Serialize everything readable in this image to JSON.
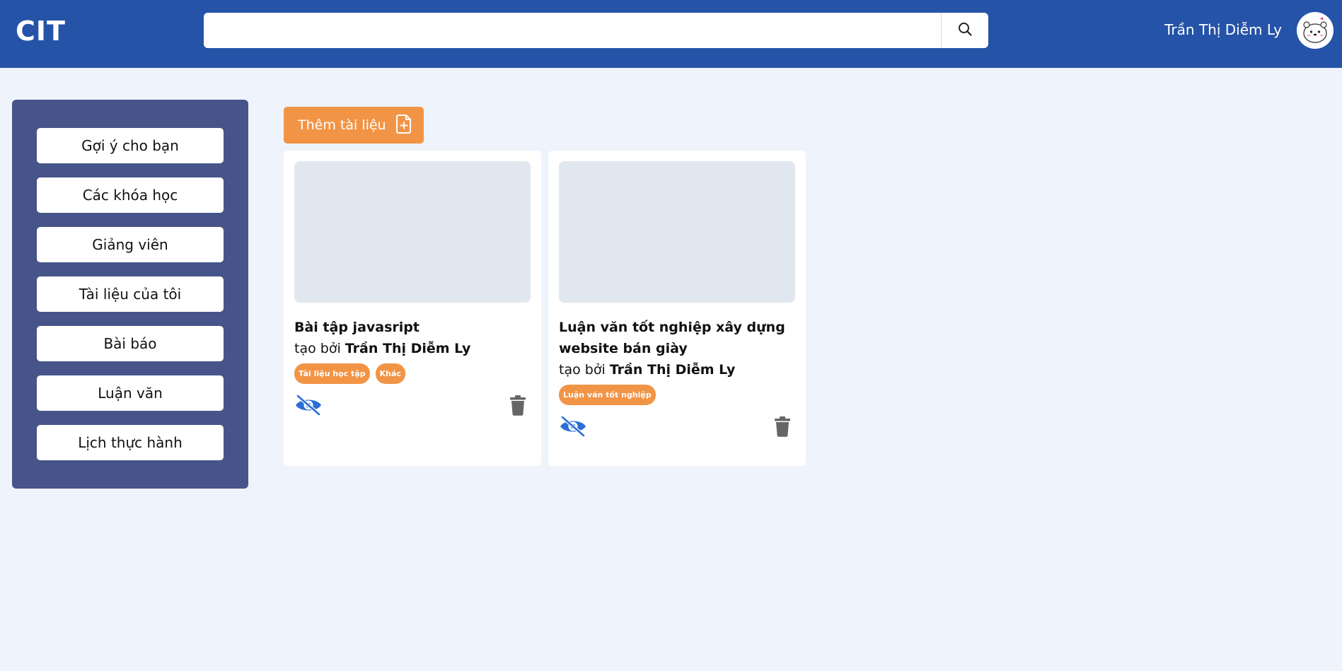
{
  "header": {
    "logo": "CIT",
    "search": {
      "value": "",
      "placeholder": ""
    },
    "user_name": "Trần Thị Diễm Ly"
  },
  "sidebar": {
    "items": [
      {
        "label": "Gợi ý cho bạn"
      },
      {
        "label": "Các khóa học"
      },
      {
        "label": "Giảng viên"
      },
      {
        "label": "Tài liệu của tôi"
      },
      {
        "label": "Bài báo"
      },
      {
        "label": "Luận văn"
      },
      {
        "label": "Lịch thực hành"
      }
    ]
  },
  "main": {
    "add_button_label": "Thêm tài liệu",
    "cards": [
      {
        "title": "Bài tập javasript",
        "created_by_prefix": "tạo bởi",
        "author": "Trần Thị Diễm Ly",
        "tags": [
          "Tài liệu học tập",
          "Khác"
        ]
      },
      {
        "title": "Luận văn tốt nghiệp xây dựng website bán giày",
        "created_by_prefix": "tạo bởi",
        "author": "Trần Thị Diễm Ly",
        "tags": [
          "Luận văn tốt nghiệp"
        ]
      }
    ]
  },
  "colors": {
    "header_bg": "#2553a8",
    "sidebar_bg": "#465489",
    "accent_orange": "#f29446",
    "eye_icon": "#2a6fd6",
    "trash_icon": "#666666",
    "page_bg": "#eff3fc"
  },
  "icons": {
    "search": "search-icon",
    "add_document": "file-plus-icon",
    "visibility": "eye-slash-icon",
    "delete": "trash-icon"
  }
}
